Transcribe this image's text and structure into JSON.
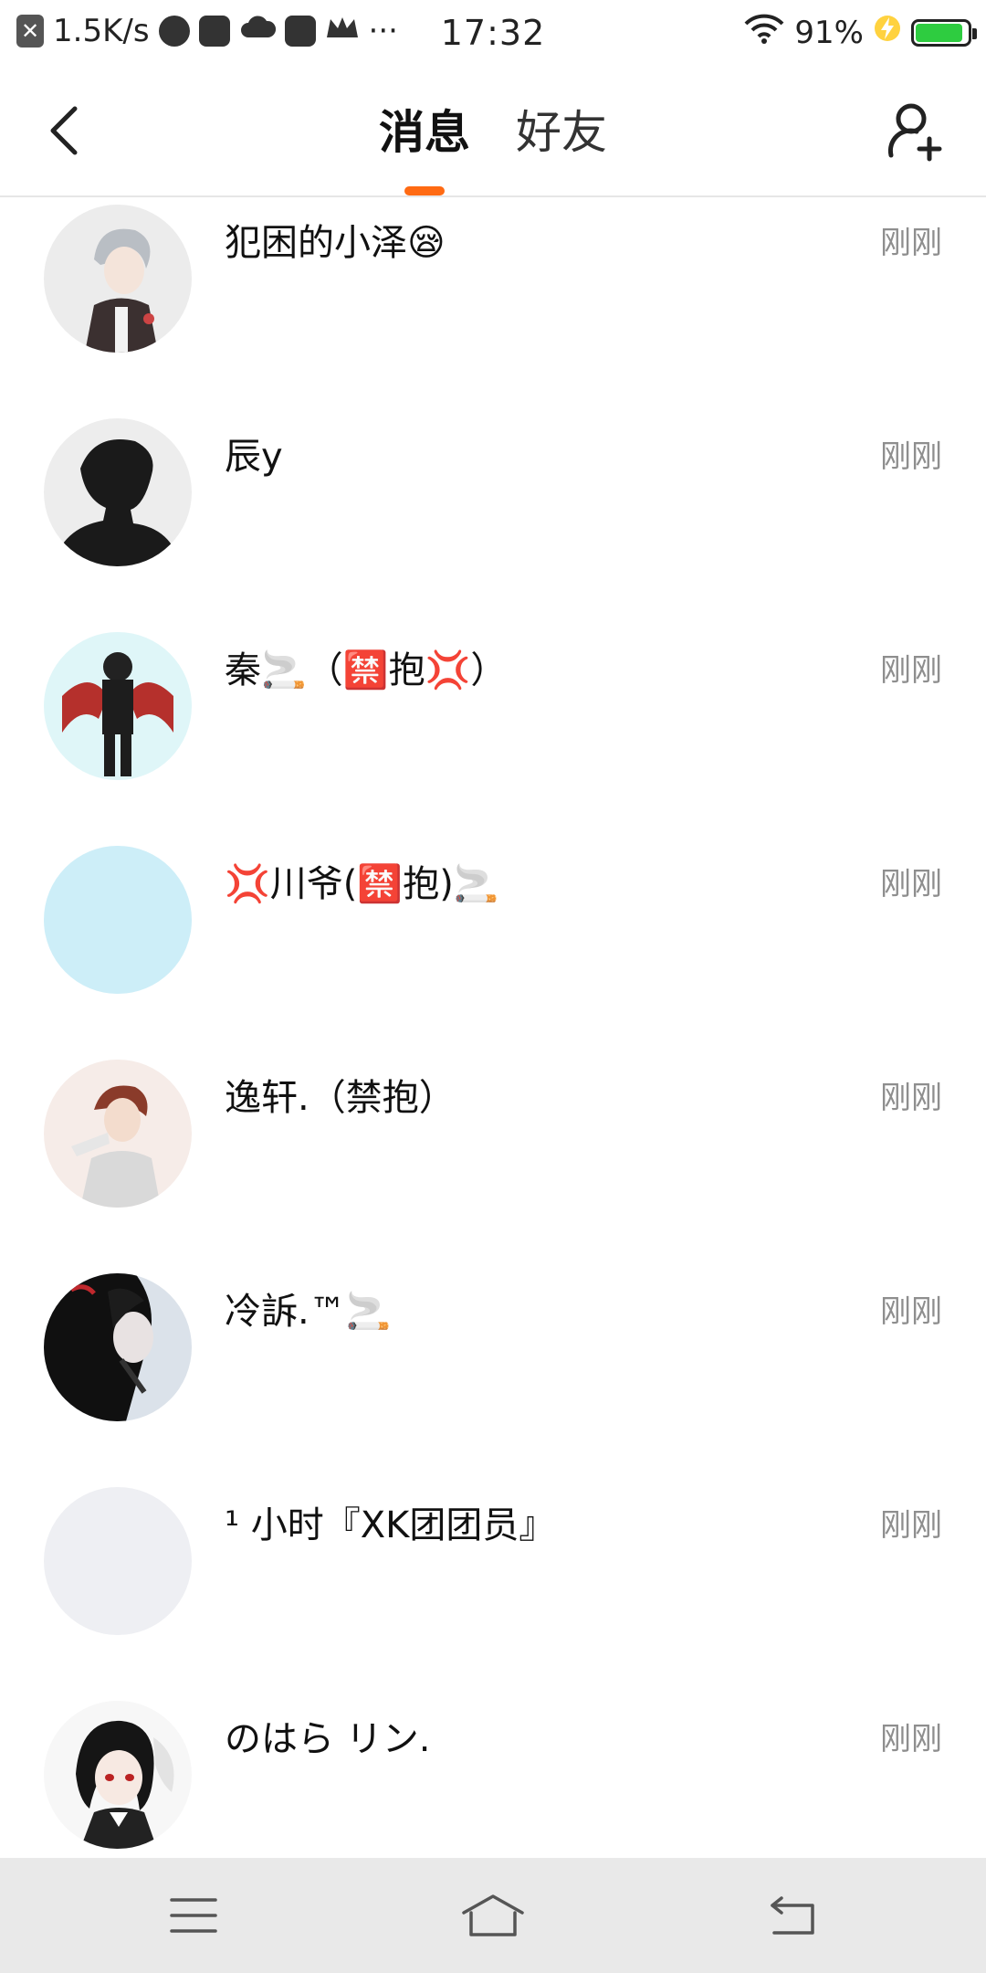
{
  "status_bar": {
    "network_speed": "1.5K/s",
    "more": "···",
    "time": "17:32",
    "battery_percent": "91%",
    "battery_level": 0.91,
    "icons": [
      "close-box-icon",
      "planet-icon",
      "mail-icon",
      "cloud-icon",
      "tiktok-icon",
      "crown-icon",
      "wifi-icon",
      "charging-icon",
      "battery-icon"
    ]
  },
  "header": {
    "tabs": [
      {
        "label": "消息",
        "active": true
      },
      {
        "label": "好友",
        "active": false
      }
    ],
    "accent_color": "#ff6a13"
  },
  "messages": [
    {
      "name": "犯困的小泽😪",
      "time": "刚刚",
      "avatar": "anime-boy-silver-hair"
    },
    {
      "name": "辰y",
      "time": "刚刚",
      "avatar": "silhouette-boy"
    },
    {
      "name": "秦🚬（🈲抱💢）",
      "time": "刚刚",
      "avatar": "demon-wings-character"
    },
    {
      "name": "💢川爷(🈲抱)🚬",
      "time": "刚刚",
      "avatar": "plain-light-blue"
    },
    {
      "name": "逸轩.（禁抱）",
      "time": "刚刚",
      "avatar": "anime-boy-red-hair"
    },
    {
      "name": "冷訴.™🚬",
      "time": "刚刚",
      "avatar": "dark-hooded-character"
    },
    {
      "name": "¹ 小时『XK团团员』",
      "time": "刚刚",
      "avatar": "plain-light-gray"
    },
    {
      "name": "のはら リン.",
      "time": "刚刚",
      "avatar": "anime-girl-black-hair"
    }
  ],
  "system_nav": {
    "buttons": [
      "menu-icon",
      "home-icon",
      "back-icon"
    ]
  }
}
